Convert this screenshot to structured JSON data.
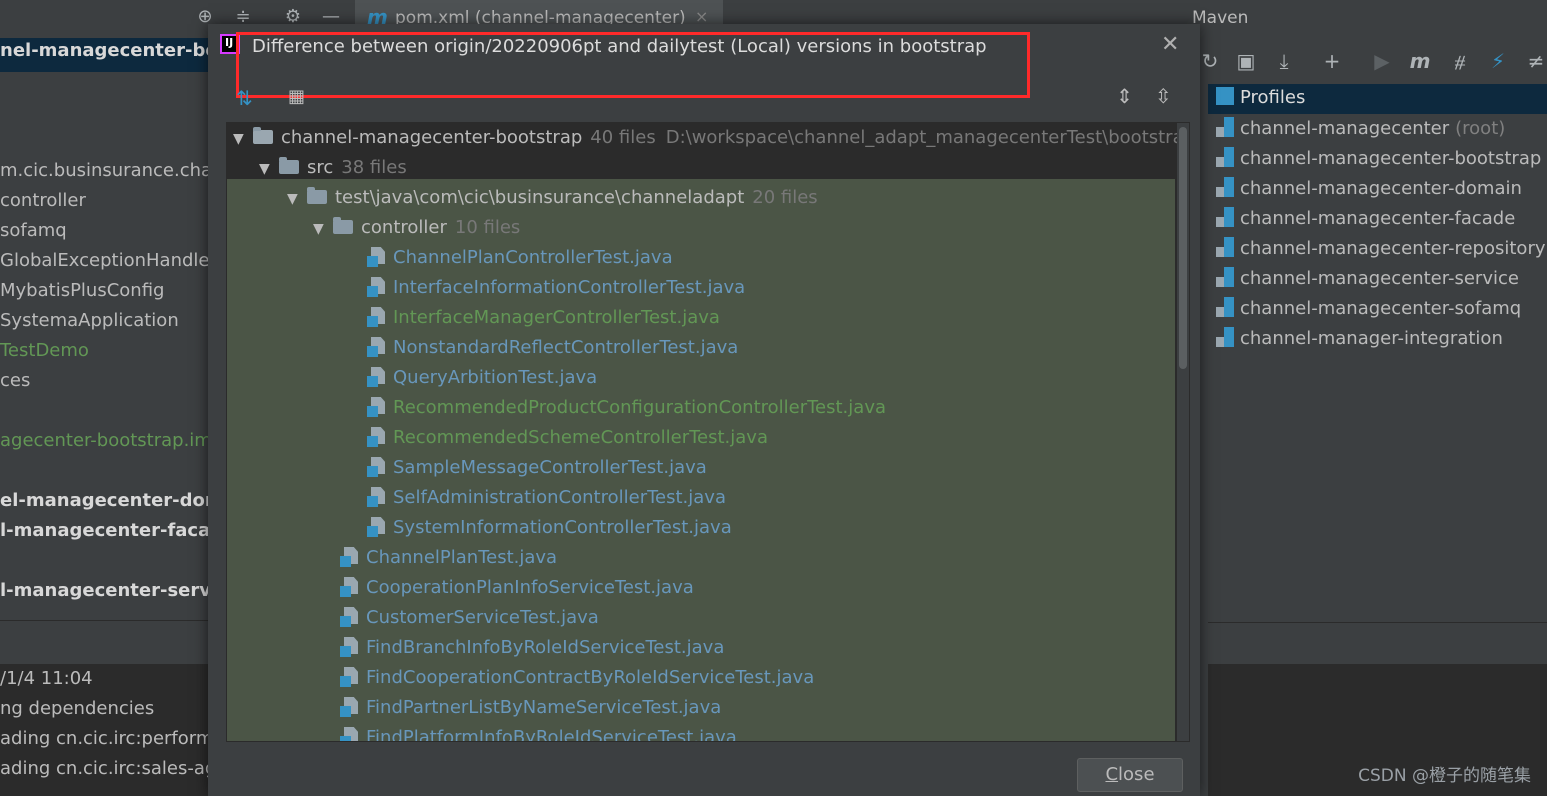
{
  "editor": {
    "tab_icon": "m",
    "tab_label": "pom.xml (channel-managecenter)",
    "tab_close": "×"
  },
  "left_panel": {
    "items": [
      {
        "text": "nel-managecenter-boo",
        "style": "bold"
      },
      {
        "text": "m.cic.businsurance.chann",
        "style": "normal"
      },
      {
        "text": "controller",
        "style": "normal"
      },
      {
        "text": "sofamq",
        "style": "normal"
      },
      {
        "text": "GlobalExceptionHandler",
        "style": "normal"
      },
      {
        "text": "MybatisPlusConfig",
        "style": "normal"
      },
      {
        "text": "SystemaApplication",
        "style": "normal"
      },
      {
        "text": "TestDemo",
        "style": "green"
      },
      {
        "text": "ces",
        "style": "normal"
      },
      {
        "text": "agecenter-bootstrap.im",
        "style": "green"
      },
      {
        "text": "el-managecenter-doma",
        "style": "bold"
      },
      {
        "text": "l-managecenter-facade",
        "style": "bold"
      },
      {
        "text": "l-managecenter-service",
        "style": "bold"
      },
      {
        "text": "/1/4 11:04",
        "style": "normal"
      },
      {
        "text": "ng dependencies",
        "style": "normal"
      },
      {
        "text": "ading cn.cic.irc:performa",
        "style": "normal"
      },
      {
        "text": "ading cn.cic.irc:sales-ago",
        "style": "normal"
      }
    ]
  },
  "maven": {
    "title": "Maven",
    "profiles_label": "Profiles",
    "root_suffix": "(root)",
    "projects": [
      "channel-managecenter",
      "channel-managecenter-bootstrap",
      "channel-managecenter-domain",
      "channel-managecenter-facade",
      "channel-managecenter-repository",
      "channel-managecenter-service",
      "channel-managecenter-sofamq",
      "channel-manager-integration"
    ]
  },
  "dialog": {
    "title": "Difference between origin/20220906pt and dailytest (Local) versions in bootstrap",
    "close_label": "Close",
    "close_mnemonic": "C",
    "close_rest": "lose",
    "tree": {
      "root": {
        "name": "channel-managecenter-bootstrap",
        "count": "40 files",
        "path": "D:\\workspace\\channel_adapt_managecenterTest\\bootstrap"
      },
      "src": {
        "name": "src",
        "count": "38 files"
      },
      "pkg": {
        "name": "test\\java\\com\\cic\\businsurance\\channeladapt",
        "count": "20 files"
      },
      "controller": {
        "name": "controller",
        "count": "10 files"
      },
      "controller_files": [
        {
          "name": "ChannelPlanControllerTest.java",
          "status": "modified"
        },
        {
          "name": "InterfaceInformationControllerTest.java",
          "status": "modified"
        },
        {
          "name": "InterfaceManagerControllerTest.java",
          "status": "added"
        },
        {
          "name": "NonstandardReflectControllerTest.java",
          "status": "modified"
        },
        {
          "name": "QueryArbitionTest.java",
          "status": "modified"
        },
        {
          "name": "RecommendedProductConfigurationControllerTest.java",
          "status": "added"
        },
        {
          "name": "RecommendedSchemeControllerTest.java",
          "status": "added"
        },
        {
          "name": "SampleMessageControllerTest.java",
          "status": "modified"
        },
        {
          "name": "SelfAdministrationControllerTest.java",
          "status": "modified"
        },
        {
          "name": "SystemInformationControllerTest.java",
          "status": "modified"
        }
      ],
      "pkg_files": [
        {
          "name": "ChannelPlanTest.java",
          "status": "modified"
        },
        {
          "name": "CooperationPlanInfoServiceTest.java",
          "status": "modified"
        },
        {
          "name": "CustomerServiceTest.java",
          "status": "modified"
        },
        {
          "name": "FindBranchInfoByRoleIdServiceTest.java",
          "status": "modified"
        },
        {
          "name": "FindCooperationContractByRoleIdServiceTest.java",
          "status": "modified"
        },
        {
          "name": "FindPartnerListByNameServiceTest.java",
          "status": "modified"
        },
        {
          "name": "FindPlatformInfoByRoleIdServiceTest.java",
          "status": "modified"
        }
      ]
    }
  },
  "watermark": "CSDN @橙子的随笔集",
  "colors": {
    "modified": "#6897bb",
    "added": "#629755",
    "highlight": "#ff2a2a",
    "selection": "#0d293e"
  }
}
